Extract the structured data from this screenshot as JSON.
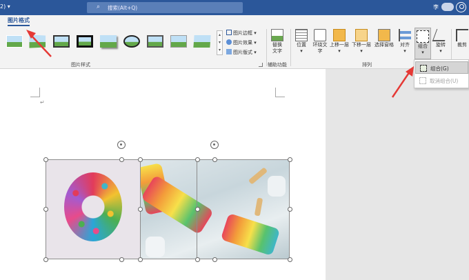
{
  "titlebar": {
    "left_text": "2) ▾",
    "search_placeholder": "搜索(Alt+Q)",
    "user": "李"
  },
  "tabs": {
    "active": "图片格式"
  },
  "ribbon": {
    "styles_group_label": "图片样式",
    "picture_border": "图片边框",
    "picture_effects": "图片效果",
    "picture_layout": "图片版式",
    "accessibility_label": "辅助功能",
    "alt_text": [
      "替换",
      "文字"
    ],
    "arrange_label": "排列",
    "position": "位置",
    "wrap_text": [
      "环绕文",
      "字"
    ],
    "bring_forward": "上移一层",
    "send_backward": "下移一层",
    "selection_pane": "选择窗格",
    "align": "对齐",
    "group": "组合",
    "rotate": "旋转",
    "crop": "裁剪"
  },
  "group_menu": {
    "group_item": "组合(G)",
    "ungroup_item": "取消组合(U)"
  },
  "document": {
    "paragraph_mark": "↵"
  },
  "colors": {
    "titlebar": "#2b579a",
    "accent": "#2b579a",
    "arrow": "#e53935"
  }
}
